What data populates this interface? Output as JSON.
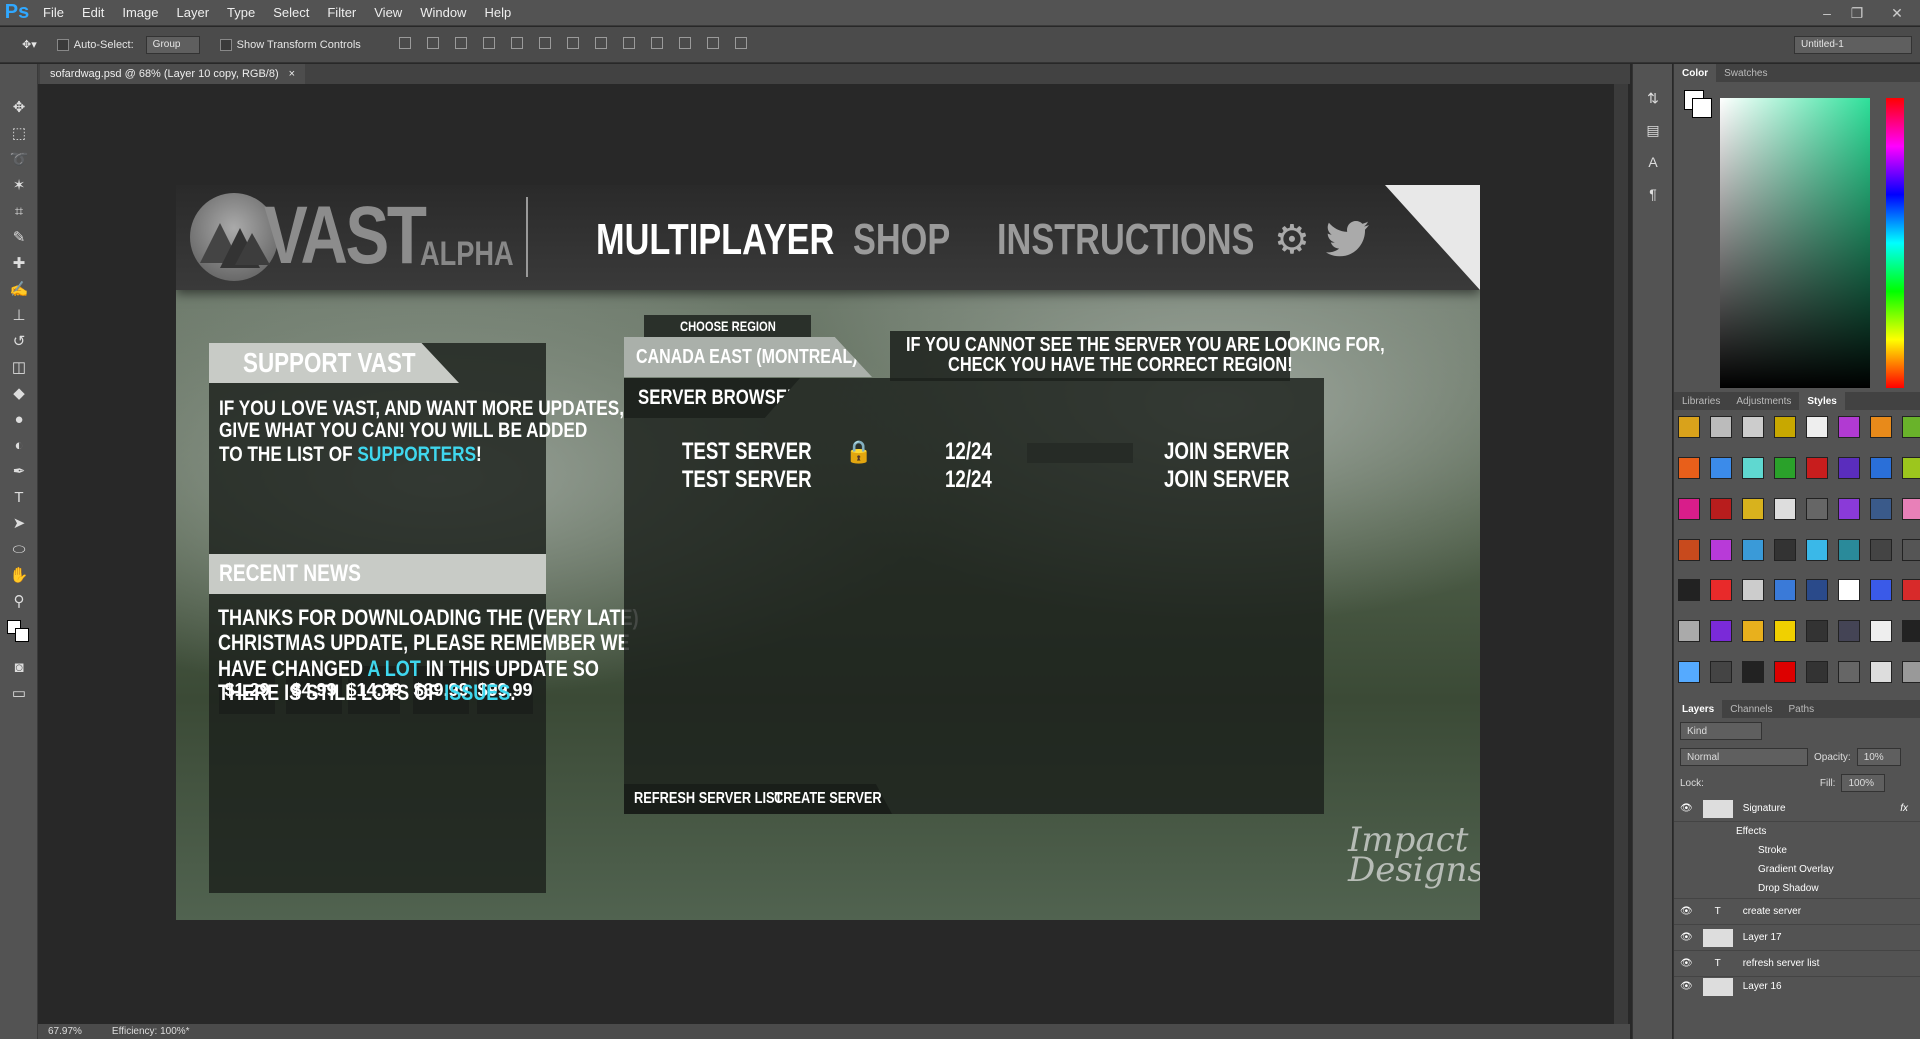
{
  "app": {
    "logo": "Ps",
    "menu": [
      "File",
      "Edit",
      "Image",
      "Layer",
      "Type",
      "Select",
      "Filter",
      "View",
      "Window",
      "Help"
    ]
  },
  "options": {
    "auto_select": "Auto-Select:",
    "group": "Group",
    "show_transform": "Show Transform Controls",
    "workspace": "Untitled-1"
  },
  "document": {
    "tab": "sofardwag.psd @ 68% (Layer 10 copy, RGB/8)",
    "close": "×"
  },
  "status": {
    "zoom": "67.97%",
    "efficiency": "Efficiency: 100%*"
  },
  "game": {
    "logo": "VAST",
    "logo_sub": "ALPHA",
    "nav": [
      "MULTIPLAYER",
      "SHOP",
      "INSTRUCTIONS"
    ],
    "support": {
      "title": "SUPPORT VAST",
      "line1": "IF YOU LOVE VAST, AND WANT MORE UPDATES,",
      "line2": "GIVE WHAT YOU CAN! YOU WILL BE ADDED",
      "line3a": "TO THE LIST OF ",
      "line3b": "SUPPORTERS",
      "line3c": "!",
      "prices": [
        "$1.29",
        "$4.99",
        "$14.99",
        "$39.99",
        "$99.99"
      ]
    },
    "news": {
      "title": "RECENT NEWS",
      "l1": "THANKS FOR DOWNLOADING THE (VERY LATE)",
      "l2": "CHRISTMAS UPDATE, PLEASE REMEMBER WE",
      "l3a": "HAVE CHANGED ",
      "l3b": "A LOT",
      "l3c": " IN THIS UPDATE SO",
      "l4a": "THERE IS STILL LOTS OF ",
      "l4b": "ISSUES",
      "l4c": "."
    },
    "region": {
      "label": "CHOOSE REGION",
      "value": "CANADA EAST (MONTREAL)",
      "note1": "IF YOU CANNOT SEE THE SERVER YOU ARE LOOKING FOR,",
      "note2": "CHECK YOU HAVE THE CORRECT REGION!"
    },
    "browser": {
      "title": "SERVER BROWSER",
      "refresh": "REFRESH SERVER LIST",
      "create": "CREATE SERVER",
      "servers": [
        {
          "name": "TEST SERVER",
          "players": "12/24",
          "action": "JOIN SERVER"
        },
        {
          "name": "TEST SERVER",
          "players": "12/24",
          "action": "JOIN SERVER"
        }
      ]
    },
    "signature1": "Impact",
    "signature2": "Designs"
  },
  "panels": {
    "color_tabs": [
      "Color",
      "Swatches"
    ],
    "styles_tabs": [
      "Libraries",
      "Adjustments",
      "Styles"
    ],
    "layers_tabs": [
      "Layers",
      "Channels",
      "Paths"
    ],
    "kind": "Kind",
    "blend": "Normal",
    "opacity_label": "Opacity:",
    "opacity": "10%",
    "lock_label": "Lock:",
    "fill_label": "Fill:",
    "fill": "100%",
    "layers": [
      "Signature",
      "Effects",
      "Stroke",
      "Gradient Overlay",
      "Drop Shadow",
      "create server",
      "Layer 17",
      "refresh server list",
      "Layer 16"
    ],
    "fx": "fx"
  }
}
